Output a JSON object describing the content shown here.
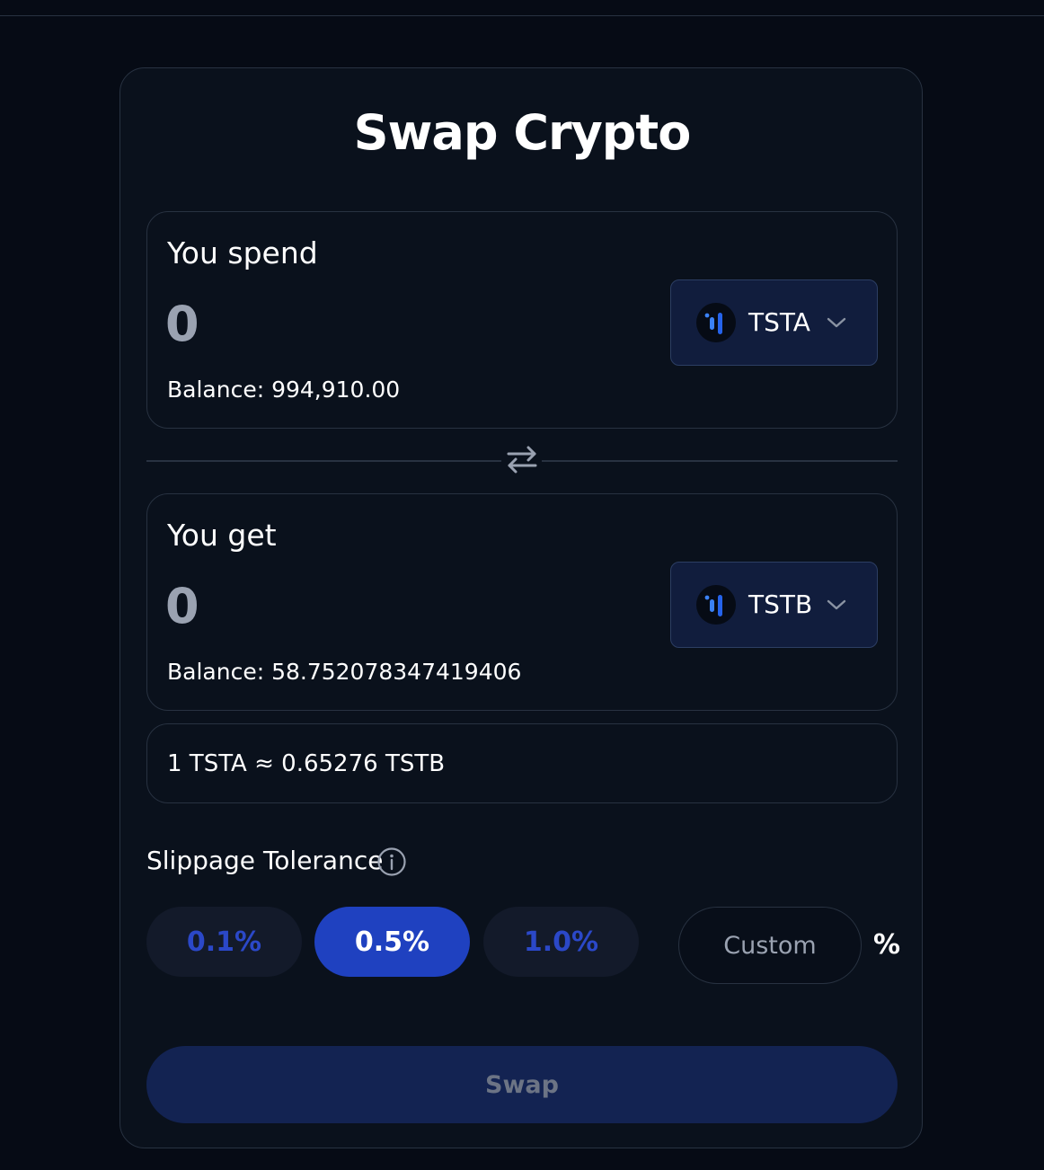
{
  "title": "Swap Crypto",
  "spend": {
    "label": "You spend",
    "amount": "0",
    "balance": "Balance: 994,910.00",
    "token": "TSTA"
  },
  "get": {
    "label": "You get",
    "amount": "0",
    "balance": "Balance: 58.752078347419406",
    "token": "TSTB"
  },
  "rate": "1 TSTA ≈ 0.65276 TSTB",
  "slippage": {
    "label": "Slippage Tolerance",
    "options": [
      "0.1%",
      "0.5%",
      "1.0%"
    ],
    "selected": "0.5%",
    "custom_placeholder": "Custom",
    "percent_sign": "%"
  },
  "swap_button": "Swap",
  "icons": {
    "token": "token-logo-icon",
    "dropdown": "chevron-down-icon",
    "swap_direction": "swap-arrows-icon",
    "info": "info-icon"
  },
  "colors": {
    "background": "#060b15",
    "card": "#0a111c",
    "border": "#283241",
    "accent": "#1f41c0",
    "token_button": "#111d3d",
    "swap_button": "#132352"
  }
}
